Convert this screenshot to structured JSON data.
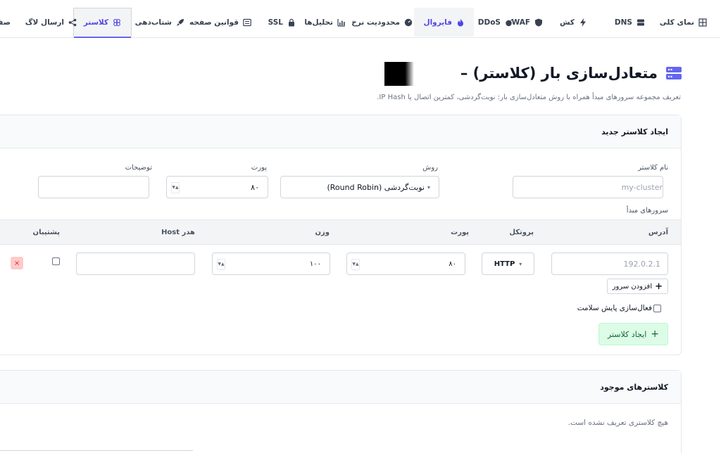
{
  "nav": {
    "tabs": [
      {
        "label": "نمای کلی",
        "icon": "grid-icon"
      },
      {
        "label": "DNS",
        "icon": "server-icon"
      },
      {
        "label": "کش",
        "icon": "bolt-icon"
      },
      {
        "label": "WAF",
        "icon": "shield-icon"
      },
      {
        "label": "DDoS",
        "icon": "bomb-icon"
      },
      {
        "label": "فایروال",
        "icon": "fire-icon"
      },
      {
        "label": "محدودیت نرخ",
        "icon": "gauge-icon"
      },
      {
        "label": "تحلیل‌ها",
        "icon": "bar-chart-icon"
      },
      {
        "label": "SSL",
        "icon": "lock-icon"
      },
      {
        "label": "قوانین صفحه",
        "icon": "list-icon"
      },
      {
        "label": "شتاب‌دهی",
        "icon": "rocket-icon"
      },
      {
        "label": "کلاستر",
        "icon": "cubes-icon"
      },
      {
        "label": "ارسال لاگ",
        "icon": "share-icon"
      },
      {
        "label": "صفحه",
        "icon": ""
      }
    ]
  },
  "page": {
    "title": "متعادل‌سازی بار (کلاستر) –",
    "subtitle": "تعریف مجموعه سرورهای مبدأ همراه با روش متعادل‌سازی بار: نوبت‌گردشی، کمترین اتصال یا IP Hash."
  },
  "create_card": {
    "heading": "ایجاد کلاستر جدید",
    "name_label": "نام کلاستر",
    "name_placeholder": "my-cluster",
    "method_label": "روش",
    "method_value": "نوبت‌گردشی (Round Robin)",
    "port_label": "پورت",
    "port_value": "۸۰",
    "desc_label": "توضیحات",
    "desc_value": "",
    "servers_label": "سرورهای مبدأ",
    "table_headers": {
      "address": "آدرس",
      "protocol": "پروتکل",
      "port": "پورت",
      "weight": "وزن",
      "host_header": "هدر Host",
      "backup": "پشتیبان"
    },
    "server_row": {
      "address_placeholder": "192.0.2.1",
      "protocol": "HTTP",
      "port": "۸۰",
      "weight": "۱۰۰",
      "host_header": "",
      "remove": "×"
    },
    "add_server_label": "افزودن سرور",
    "health_check_label": "فعال‌سازی پایش سلامت",
    "create_button": "ایجاد کلاستر"
  },
  "existing_card": {
    "heading": "کلاسترهای موجود",
    "empty": "هیچ کلاستری تعریف نشده است."
  },
  "colors": {
    "accent": "#6366f1",
    "create_bg": "#dcfce7",
    "remove_bg": "#fecaca"
  }
}
